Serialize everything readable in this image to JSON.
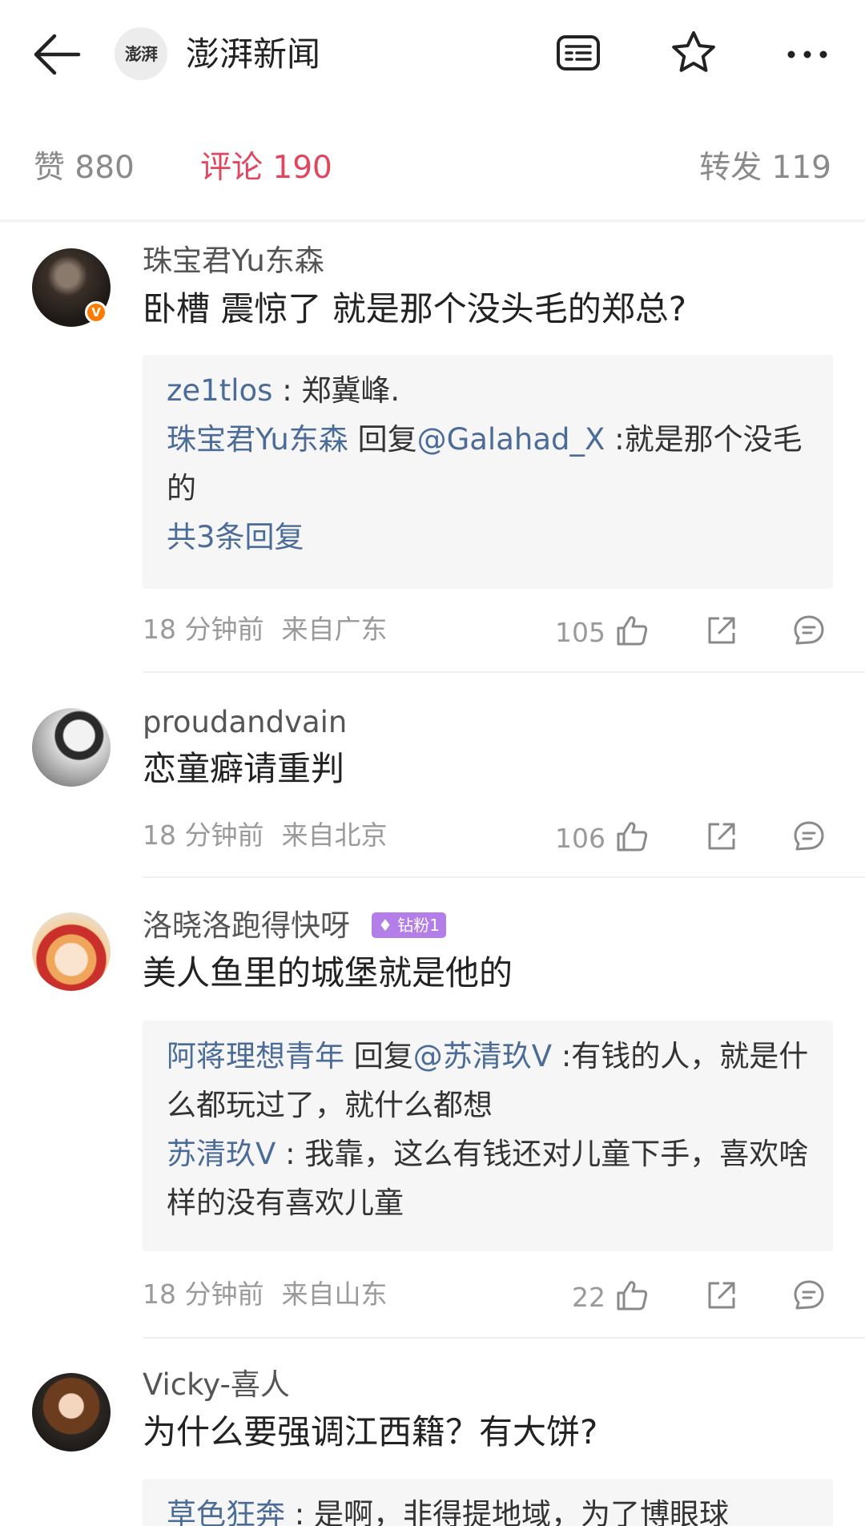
{
  "header": {
    "account_name": "澎湃新闻",
    "account_logo_text": "澎湃",
    "icons": [
      "back-arrow-icon",
      "article-list-icon",
      "star-icon",
      "more-icon"
    ]
  },
  "stats": {
    "likes": "赞 880",
    "comments": "评论 190",
    "reposts": "转发 119",
    "active_color": "#e0475f"
  },
  "comments": [
    {
      "username": "珠宝君Yu东森",
      "verified_badge": "V",
      "content": "卧槽 震惊了 就是那个没头毛的郑总?",
      "replies": [
        {
          "name": "ze1tlos",
          "text": " : 郑冀峰."
        },
        {
          "name": "珠宝君Yu东森",
          "text": " 回复",
          "mention": "@Galahad_X",
          "after": " :就是那个没毛的"
        }
      ],
      "more_replies": "共3条回复",
      "time": "18 分钟前",
      "location": "来自广东",
      "likes": "105"
    },
    {
      "username": "proudandvain",
      "content": "恋童癖请重判",
      "time": "18 分钟前",
      "location": "来自北京",
      "likes": "106"
    },
    {
      "username": "洛晓洛跑得快呀",
      "fan_badge": "钻粉1",
      "content": "美人鱼里的城堡就是他的",
      "replies": [
        {
          "name": "阿蒋理想青年",
          "text": " 回复",
          "mention": "@苏清玖V",
          "after": " :有钱的人，就是什么都玩过了，就什么都想"
        },
        {
          "name": "苏清玖V",
          "text": " : 我靠，这么有钱还对儿童下手，喜欢啥样的没有喜欢儿童"
        }
      ],
      "time": "18 分钟前",
      "location": "来自山东",
      "likes": "22"
    },
    {
      "username": "Vicky-喜人",
      "content": "为什么要强调江西籍？有大饼?",
      "replies": [
        {
          "name": "草色狂奔",
          "text": " : 是啊，非得提地域，为了博眼球"
        }
      ]
    }
  ],
  "colors": {
    "link": "#4c6c98",
    "reply_bg": "#f6f6f7",
    "meta": "#9a9a9a"
  }
}
